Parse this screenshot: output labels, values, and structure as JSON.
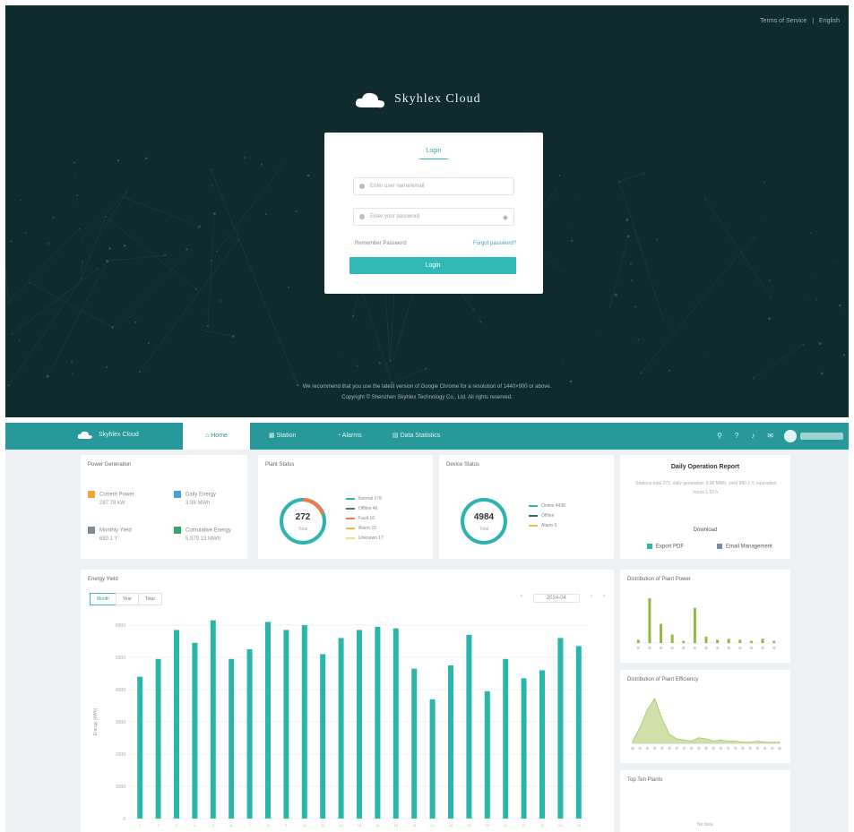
{
  "login": {
    "top_links": [
      "Terms of Service",
      "|",
      "English"
    ],
    "brand": "Skyhlex Cloud",
    "tab": "Login",
    "username_placeholder": "Enter user name/email",
    "password_placeholder": "Enter your password",
    "remember": "Remember Password",
    "forgot": "Forgot password?",
    "button": "Login",
    "footer_line1": "We recommend that you use the latest version of Google Chrome for a resolution of 1440×900 or above.",
    "footer_line2": "Copyright © Shenzhen Skyhlex Technology Co., Ltd. All rights reserved."
  },
  "dash": {
    "brand": "Skyhlex Cloud",
    "nav": {
      "home": "Home",
      "items": [
        "Station",
        "Alarms",
        "Data Statistics"
      ]
    },
    "plant_info": {
      "title": "Power Generation",
      "items": [
        {
          "label": "Current Power",
          "value": "287.78 kW",
          "color": "#f0a43a"
        },
        {
          "label": "Daily Energy",
          "value": "3.98 MWh",
          "color": "#4a9fd8"
        },
        {
          "label": "Monthly Yield",
          "value": "680.1 Y",
          "color": "#7a8d9a"
        },
        {
          "label": "Cumulative Energy",
          "value": "5,979.13 MWh",
          "color": "#3aa36b"
        }
      ]
    },
    "plant_status": {
      "title": "Plant Status",
      "total": "272",
      "sub": "Total",
      "legend": [
        {
          "label": "Normal  178",
          "color": "#2fb3b0"
        },
        {
          "label": "Offline  46",
          "color": "#3c7f7f"
        },
        {
          "label": "Fault  16",
          "color": "#f07a4a"
        },
        {
          "label": "Alarm  15",
          "color": "#f4b942"
        },
        {
          "label": "Unknown  17",
          "color": "#f7d98a"
        }
      ]
    },
    "device_status": {
      "title": "Device Status",
      "total": "4984",
      "sub": "Total",
      "legend": [
        {
          "label": "Online  4438",
          "color": "#2fb3b0"
        },
        {
          "label": "Offline  ",
          "color": "#2d6f70"
        },
        {
          "label": "Alarm  0",
          "color": "#f4b942"
        }
      ]
    },
    "report": {
      "title": "Daily Operation Report",
      "text": "Stations total 272, daily generation 3.98 MWh, yield 680.1 Y, equivalent hours 1.52 h.",
      "download": "Download",
      "btn1": "Export PDF",
      "btn2": "Email Management",
      "btn1_color": "#2fb3b0",
      "btn2_color": "#7a8d9a"
    },
    "history": {
      "title": "Energy Yield",
      "tabs": [
        "Month",
        "Year",
        "Total"
      ],
      "date": "2024-04",
      "ylabel": "Energy (kWh)"
    },
    "side1_title": "Distribution of Plant Power",
    "side2_title": "Distribution of Plant Efficiency",
    "side3_title": "Top Ten Plants",
    "side3_empty": "No data",
    "accent": "#27999a"
  },
  "chart_data": [
    {
      "type": "bar",
      "title": "Energy Yield",
      "ylabel": "Energy (kWh)",
      "ylim": [
        0,
        6000
      ],
      "yticks": [
        "0",
        "1000",
        "2000",
        "3000",
        "4000",
        "5000",
        "6000"
      ],
      "categories": [
        "1",
        "2",
        "3",
        "4",
        "5",
        "6",
        "7",
        "8",
        "9",
        "10",
        "11",
        "12",
        "13",
        "14",
        "15",
        "16",
        "17",
        "18",
        "19",
        "20",
        "21",
        "22",
        "23",
        "24",
        "25"
      ],
      "values": [
        4400,
        4950,
        5850,
        5450,
        6150,
        4950,
        5250,
        6100,
        5850,
        6000,
        5100,
        5600,
        5850,
        5950,
        5900,
        4650,
        3700,
        4750,
        5700,
        3950,
        4950,
        4350,
        4600,
        5600,
        5350
      ],
      "color": "#2bb6ac"
    },
    {
      "type": "bar",
      "title": "Distribution of Plant Power",
      "values": [
        3,
        42,
        18,
        8,
        2,
        33,
        6,
        3,
        4,
        3,
        2,
        4,
        2
      ],
      "color": "#93b84a"
    },
    {
      "type": "area",
      "title": "Distribution of Plant Efficiency",
      "values": [
        2,
        14,
        30,
        40,
        22,
        8,
        4,
        3,
        2,
        5,
        4,
        2,
        3,
        2,
        2,
        1,
        1,
        2,
        1,
        1,
        1
      ],
      "color": "#a3c35a"
    }
  ]
}
